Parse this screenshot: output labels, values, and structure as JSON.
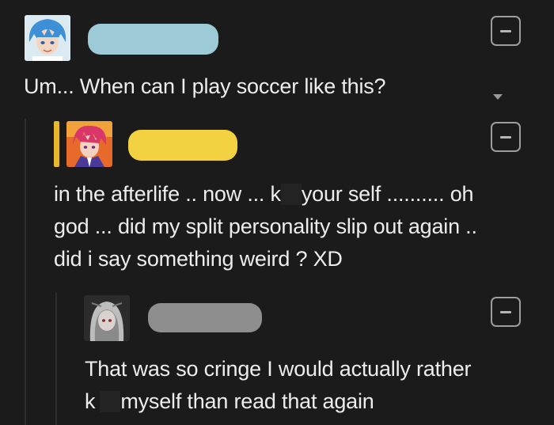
{
  "colors": {
    "background": "#1b1b1b",
    "text": "#ececec",
    "pill_1": "#9ccad6",
    "pill_2": "#f2d240",
    "pill_3": "#8e8e8e",
    "accent_bar": "#e9b92d",
    "button_border": "#9d9d9d"
  },
  "comments": [
    {
      "avatar_icon": "anime-blue-hair-avatar",
      "username": "",
      "collapse_icon": "minus-icon",
      "text_lines": [
        "Um... When can I play soccer like this?"
      ]
    },
    {
      "avatar_icon": "anime-red-hair-avatar",
      "username": "",
      "collapse_icon": "minus-icon",
      "line1_pre": "in the afterlife .. now ... k",
      "line1_post": "your self .......... oh",
      "line2": "god ... did my split personality slip out again ..",
      "line3": "did i say something weird ? XD"
    },
    {
      "avatar_icon": "anime-white-hood-avatar",
      "username": "",
      "collapse_icon": "minus-icon",
      "line1": "That was so cringe I would actually rather",
      "line2_pre": "k",
      "line2_post": "myself than read that again"
    }
  ]
}
